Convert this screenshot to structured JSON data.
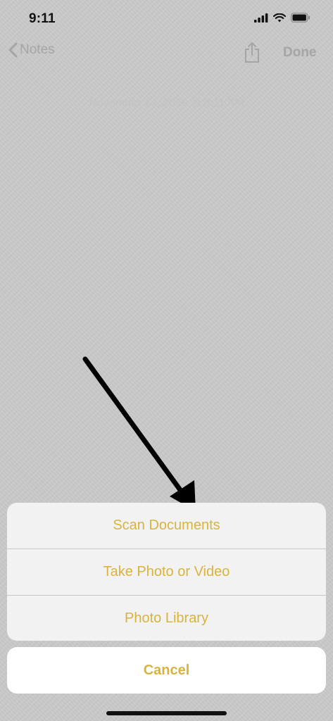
{
  "status_bar": {
    "time": "9:11",
    "icons": [
      "cellular-signal-icon",
      "wifi-icon",
      "battery-icon"
    ]
  },
  "navbar": {
    "back_label": "Notes",
    "share_icon": "share-icon",
    "done_label": "Done"
  },
  "note": {
    "date_text": "November 14, 2019 at 9:11 AM"
  },
  "annotation": {
    "icon": "arrow-icon",
    "color": "#000000"
  },
  "action_sheet": {
    "items": [
      {
        "label": "Scan Documents"
      },
      {
        "label": "Take Photo or Video"
      },
      {
        "label": "Photo Library"
      }
    ],
    "cancel_label": "Cancel"
  },
  "colors": {
    "accent": "#d8b33e",
    "background": "#c9c9c9",
    "sheet": "#f2f2f2"
  }
}
